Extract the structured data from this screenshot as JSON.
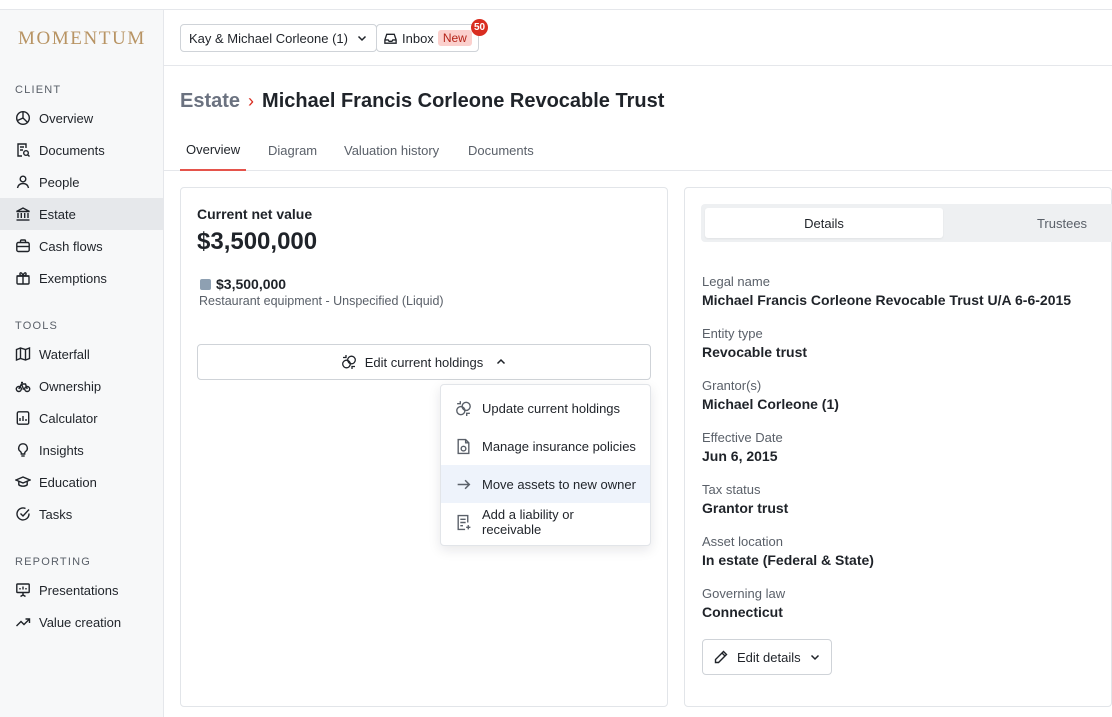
{
  "brand": {
    "logo": "MOMENTUM",
    "logo_color": "#b89464"
  },
  "sidebar": {
    "sections": [
      {
        "title": "CLIENT",
        "items": [
          {
            "label": "Overview",
            "icon": "pie-icon"
          },
          {
            "label": "Documents",
            "icon": "document-search-icon"
          },
          {
            "label": "People",
            "icon": "person-icon"
          },
          {
            "label": "Estate",
            "icon": "bank-icon",
            "active": true
          },
          {
            "label": "Cash flows",
            "icon": "briefcase-icon"
          },
          {
            "label": "Exemptions",
            "icon": "gift-icon"
          }
        ]
      },
      {
        "title": "TOOLS",
        "items": [
          {
            "label": "Waterfall",
            "icon": "map-icon"
          },
          {
            "label": "Ownership",
            "icon": "bicycle-icon"
          },
          {
            "label": "Calculator",
            "icon": "calculator-icon"
          },
          {
            "label": "Insights",
            "icon": "lightbulb-icon"
          },
          {
            "label": "Education",
            "icon": "graduation-cap-icon"
          },
          {
            "label": "Tasks",
            "icon": "check-circle-icon"
          }
        ]
      },
      {
        "title": "REPORTING",
        "items": [
          {
            "label": "Presentations",
            "icon": "presentation-icon"
          },
          {
            "label": "Value creation",
            "icon": "trending-up-icon"
          }
        ]
      }
    ]
  },
  "topbar": {
    "client_selector": "Kay & Michael Corleone (1)",
    "inbox_label": "Inbox",
    "new_pill": "New",
    "inbox_count": "50"
  },
  "header": {
    "breadcrumb_parent": "Estate",
    "separator": "›",
    "title": "Michael Francis Corleone Revocable Trust"
  },
  "tabs": [
    "Overview",
    "Diagram",
    "Valuation history",
    "Documents"
  ],
  "left_card": {
    "net_value_label": "Current net value",
    "net_value": "$3,500,000",
    "holding_value": "$3,500,000",
    "holding_desc": "Restaurant equipment - Unspecified (Liquid)",
    "edit_button": "Edit current holdings",
    "menu": [
      {
        "label": "Update current holdings",
        "icon": "refresh-link-icon"
      },
      {
        "label": "Manage insurance policies",
        "icon": "policy-document-icon"
      },
      {
        "label": "Move assets to new owner",
        "icon": "arrow-right-icon",
        "highlighted": true
      },
      {
        "label": "Add a liability or receivable",
        "icon": "receipt-add-icon"
      }
    ]
  },
  "right_card": {
    "segments": [
      "Details",
      "Trustees"
    ],
    "fields": [
      {
        "label": "Legal name",
        "value": "Michael Francis Corleone Revocable Trust U/A 6-6-2015"
      },
      {
        "label": "Entity type",
        "value": "Revocable trust"
      },
      {
        "label": "Grantor(s)",
        "value": "Michael Corleone (1)"
      },
      {
        "label": "Effective Date",
        "value": "Jun 6, 2015"
      },
      {
        "label": "Tax status",
        "value": "Grantor trust"
      },
      {
        "label": "Asset location",
        "value": "In estate (Federal & State)"
      },
      {
        "label": "Governing law",
        "value": "Connecticut"
      }
    ],
    "edit_button": "Edit details"
  },
  "colors": {
    "accent_red": "#d92d20",
    "tab_underline": "#e5534b",
    "menu_highlight": "#eef3fb"
  }
}
